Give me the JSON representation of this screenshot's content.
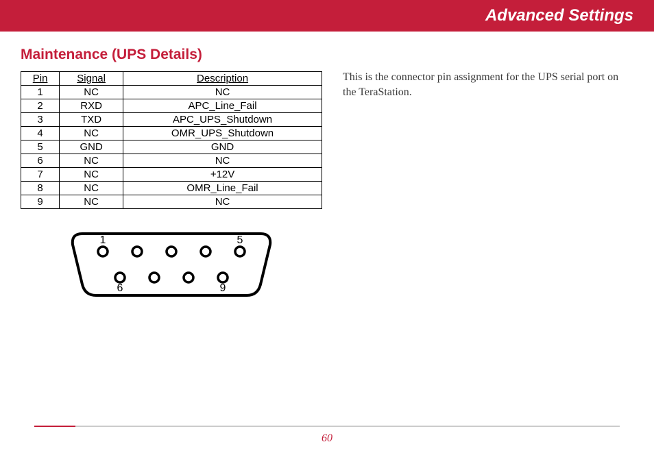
{
  "header": {
    "title": "Advanced Settings"
  },
  "section": {
    "title": "Maintenance (UPS Details)"
  },
  "table": {
    "headers": {
      "pin": "Pin",
      "signal": "Signal",
      "description": "Description"
    },
    "rows": [
      {
        "pin": "1",
        "signal": "NC",
        "description": "NC"
      },
      {
        "pin": "2",
        "signal": "RXD",
        "description": "APC_Line_Fail"
      },
      {
        "pin": "3",
        "signal": "TXD",
        "description": "APC_UPS_Shutdown"
      },
      {
        "pin": "4",
        "signal": "NC",
        "description": "OMR_UPS_Shutdown"
      },
      {
        "pin": "5",
        "signal": "GND",
        "description": "GND"
      },
      {
        "pin": "6",
        "signal": "NC",
        "description": "NC"
      },
      {
        "pin": "7",
        "signal": "NC",
        "description": "+12V"
      },
      {
        "pin": "8",
        "signal": "NC",
        "description": "OMR_Line_Fail"
      },
      {
        "pin": "9",
        "signal": "NC",
        "description": "NC"
      }
    ]
  },
  "connector": {
    "labels": {
      "top_left": "1",
      "top_right": "5",
      "bottom_left": "6",
      "bottom_right": "9"
    }
  },
  "description": "This is the connector pin assignment for the UPS serial port on the TeraStation.",
  "page_number": "60"
}
